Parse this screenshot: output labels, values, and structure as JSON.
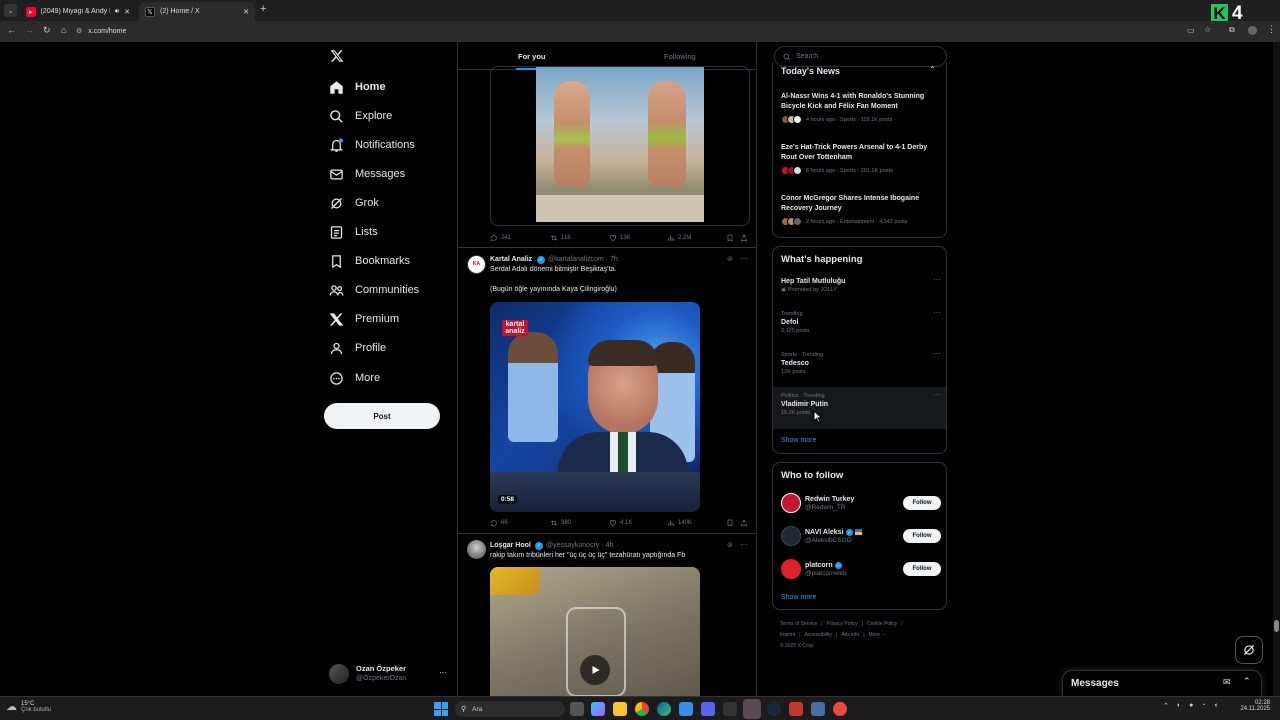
{
  "browser": {
    "tabs": [
      {
        "title": "(2049) Miyagi & Andy Pana",
        "icon": "youtube-icon",
        "color": "#ff0033"
      },
      {
        "title": "(2) Home / X",
        "icon": "x-logo-icon",
        "color": "#000000"
      }
    ],
    "url": "x.com/home",
    "overlay_badge": "4"
  },
  "sidebar": {
    "items": [
      {
        "label": "Home",
        "icon": "home-icon"
      },
      {
        "label": "Explore",
        "icon": "search-icon"
      },
      {
        "label": "Notifications",
        "icon": "bell-icon"
      },
      {
        "label": "Messages",
        "icon": "mail-icon"
      },
      {
        "label": "Grok",
        "icon": "grok-icon"
      },
      {
        "label": "Lists",
        "icon": "list-icon"
      },
      {
        "label": "Bookmarks",
        "icon": "bookmark-icon"
      },
      {
        "label": "Communities",
        "icon": "people-icon"
      },
      {
        "label": "Premium",
        "icon": "x-logo-icon"
      },
      {
        "label": "Profile",
        "icon": "person-icon"
      },
      {
        "label": "More",
        "icon": "more-circle-icon"
      }
    ],
    "post_label": "Post",
    "account": {
      "name": "Ozan Özpeker",
      "handle": "@OzpekerOzan",
      "more": "···"
    }
  },
  "feed": {
    "tabs": [
      "For you",
      "Following"
    ],
    "tweet0": {
      "replies": "241",
      "reposts": "118",
      "likes": "13K",
      "views": "2.2M"
    },
    "tweet1": {
      "name": "Kartal Analiz",
      "handle": "@kartalanalizcom",
      "time": "· 7h",
      "text1": "Serdal Adalı dönemi bitmiştir Beşiktaş'ta.",
      "text2": "(Bugün öğle yayınında Kaya Çilingiroğlu)",
      "media_logo": "kartal analiz",
      "duration": "0:58",
      "replies": "66",
      "reposts": "380",
      "likes": "4.1K",
      "views": "140K"
    },
    "tweet2": {
      "name": "Loşgar Hool",
      "handle": "@yessaykonocry",
      "time": "· 4h",
      "text": "rakip takım tribünleri her \"üç üç üç üç\" tezahüratı yaptığında Fb"
    }
  },
  "right": {
    "search_placeholder": "Search",
    "todays_news": {
      "title": "Today's News",
      "items": [
        {
          "title": "Al-Nassr Wins 4-1 with Ronaldo's Stunning Bicycle Kick and Félix Fan Moment",
          "meta": "4 hours ago · Sports · 119.1K posts"
        },
        {
          "title": "Eze's Hat-Trick Powers Arsenal to 4-1 Derby Rout Over Tottenham",
          "meta": "6 hours ago · Sports · 201.1K posts"
        },
        {
          "title": "Conor McGregor Shares Intense Ibogaine Recovery Journey",
          "meta": "2 hours ago · Entertainment · 4,342 posts"
        }
      ]
    },
    "happening": {
      "title": "What's happening",
      "items": [
        {
          "category": "",
          "name": "Hep Tatil Mutluluğu",
          "posts": "Promoted by JOLLY"
        },
        {
          "category": "Trending",
          "name": "Defol",
          "posts": "2,125 posts"
        },
        {
          "category": "Sports · Trending",
          "name": "Tedesco",
          "posts": "12K posts"
        },
        {
          "category": "Politics · Trending",
          "name": "Vladimir Putin",
          "posts": "15.2K posts"
        }
      ],
      "show_more": "Show more"
    },
    "who_to_follow": {
      "title": "Who to follow",
      "items": [
        {
          "name": "Redwin Turkey",
          "handle": "@Redwin_TR",
          "button": "Follow",
          "color": "#c0182c"
        },
        {
          "name": "NAVI Aleksi",
          "handle": "@AleksibCSGO",
          "button": "Follow",
          "color": "#1b2838"
        },
        {
          "name": "platcorn",
          "handle": "@platcornweb",
          "button": "Follow",
          "color": "#e0202a"
        }
      ],
      "show_more": "Show more"
    },
    "footer": {
      "line1": [
        "Terms of Service",
        "Privacy Policy",
        "Cookie Policy"
      ],
      "line2": [
        "Imprint",
        "Accessibility",
        "Ads info",
        "More ···"
      ],
      "copyright": "© 2025 X Corp."
    },
    "messages_drawer": "Messages"
  },
  "taskbar": {
    "weather_temp": "15°C",
    "weather_text": "Çok bulutlu",
    "search": "Ara",
    "time": "02:28",
    "date": "24.11.2025"
  },
  "colors": {
    "accent": "#1d9bf0",
    "bg": "#000000",
    "border": "#2f3336"
  }
}
